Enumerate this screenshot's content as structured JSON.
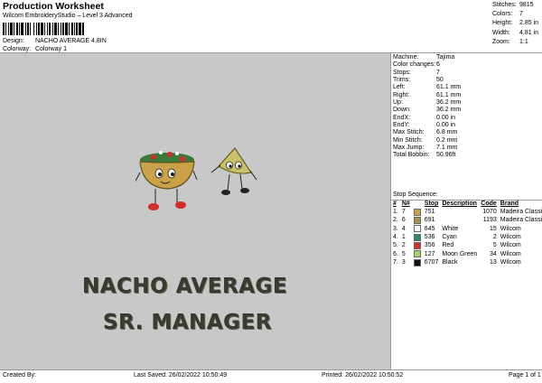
{
  "header": {
    "title": "Production Worksheet",
    "software": "Wilcom EmbroideryStudio – Level 3 Advanced",
    "barcode_label": "Barcode",
    "design_label": "Design:",
    "design_value": "NACHO AVERAGE 4,8IN",
    "colorway_label": "Colorway:",
    "colorway_value": "Colorway 1"
  },
  "summary": [
    {
      "label": "Stitches:",
      "value": "9815"
    },
    {
      "label": "Colors:",
      "value": "7"
    },
    {
      "label": "Height:",
      "value": "2.85 in"
    },
    {
      "label": "Width:",
      "value": "4.81 in"
    },
    {
      "label": "Zoom:",
      "value": "1:1"
    }
  ],
  "design": {
    "line1": "NACHO AVERAGE",
    "line2": "SR. MANAGER",
    "bowl_color": "#c9a24a",
    "guac_color": "#3b7a3a",
    "tomato_color": "#d0302a",
    "chip_color": "#c9c06a"
  },
  "properties": [
    {
      "label": "Machine:",
      "value": "Tajima"
    },
    {
      "label": "Color changes:",
      "value": "6"
    },
    {
      "label": "Stops:",
      "value": "7"
    },
    {
      "label": "Trims:",
      "value": "50"
    },
    {
      "label": "Left:",
      "value": "61.1 mm"
    },
    {
      "label": "Right:",
      "value": "61.1 mm"
    },
    {
      "label": "Up:",
      "value": "36.2 mm"
    },
    {
      "label": "Down:",
      "value": "36.2 mm"
    },
    {
      "label": "EndX:",
      "value": "0.00 in"
    },
    {
      "label": "EndY:",
      "value": "0.00 in"
    },
    {
      "label": "Max Stitch:",
      "value": "6.8 mm"
    },
    {
      "label": "Min Stitch:",
      "value": "0.2 mm"
    },
    {
      "label": "Max Jump:",
      "value": "7.1 mm"
    },
    {
      "label": "Total Bobbin:",
      "value": "50.96ft"
    }
  ],
  "stop_sequence": {
    "title": "Stop Sequence:",
    "headers": [
      "#",
      "N#",
      "",
      "Stop",
      "Description",
      "Code",
      "Brand"
    ],
    "rows": [
      {
        "n": "1.",
        "needle": "7",
        "color": "#c9a24a",
        "stop": "751",
        "desc": "",
        "code": "1070",
        "brand": "Madeira Classic 40"
      },
      {
        "n": "2.",
        "needle": "6",
        "color": "#a8924e",
        "stop": "691",
        "desc": "",
        "code": "1193",
        "brand": "Madeira Classic 40"
      },
      {
        "n": "3.",
        "needle": "4",
        "color": "#ffffff",
        "stop": "645",
        "desc": "White",
        "code": "15",
        "brand": "Wilcom"
      },
      {
        "n": "4.",
        "needle": "1",
        "color": "#2f8a6a",
        "stop": "536",
        "desc": "Cyan",
        "code": "2",
        "brand": "Wilcom"
      },
      {
        "n": "5.",
        "needle": "2",
        "color": "#d0302a",
        "stop": "356",
        "desc": "Red",
        "code": "5",
        "brand": "Wilcom"
      },
      {
        "n": "6.",
        "needle": "5",
        "color": "#a9d36a",
        "stop": "127",
        "desc": "Moon Green",
        "code": "34",
        "brand": "Wilcom"
      },
      {
        "n": "7.",
        "needle": "3",
        "color": "#111111",
        "stop": "6707",
        "desc": "Black",
        "code": "13",
        "brand": "Wilcom"
      }
    ]
  },
  "footer": {
    "created_by": "Created By:",
    "last_saved": "Last Saved: 26/02/2022 10:50:49",
    "printed": "Printed: 26/02/2022 10:50:52",
    "page": "Page 1 of 1"
  }
}
